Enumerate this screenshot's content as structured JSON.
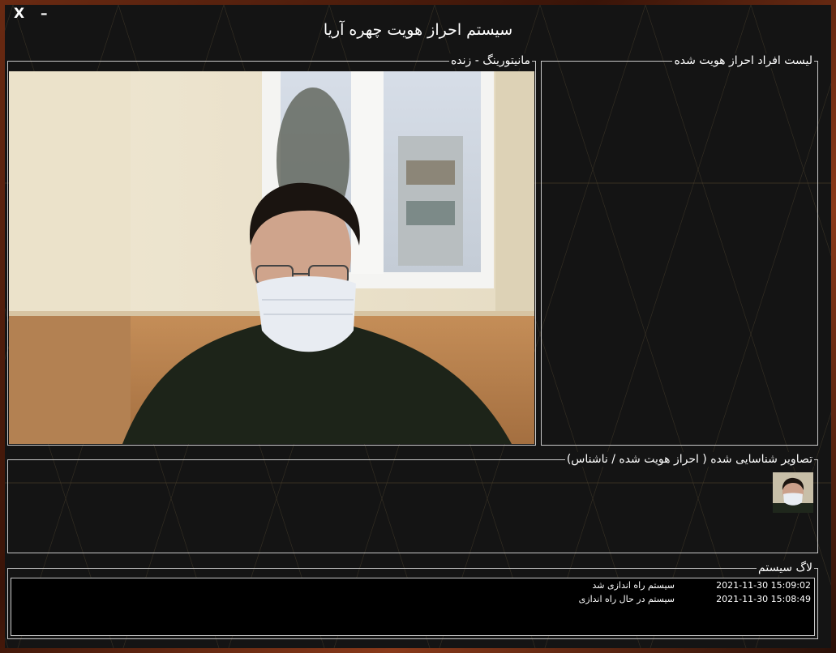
{
  "window": {
    "title": "سیستم احراز هویت چهره آریا",
    "close_label": "X",
    "minimize_label": "–"
  },
  "monitoring": {
    "legend": "مانیتورینگ  - زنده"
  },
  "identified_list": {
    "legend": "لیست افراد احراز هویت شده"
  },
  "detected_images": {
    "legend": "تصاویر شناسایی شده ( احراز هویت شده / ناشناس)"
  },
  "system_log": {
    "legend": "لاگ سیستم",
    "entries": [
      {
        "timestamp": "2021-11-30 15:09:02",
        "message": "سیستم راه اندازی شد"
      },
      {
        "timestamp": "2021-11-30 15:08:49",
        "message": "سیستم در حال راه اندازی"
      }
    ]
  },
  "colors": {
    "window_bg": "#141414",
    "border": "#c8c8c8",
    "text": "#ffffff",
    "log_bg": "#000000",
    "outer_bg": "#6a2a12"
  }
}
